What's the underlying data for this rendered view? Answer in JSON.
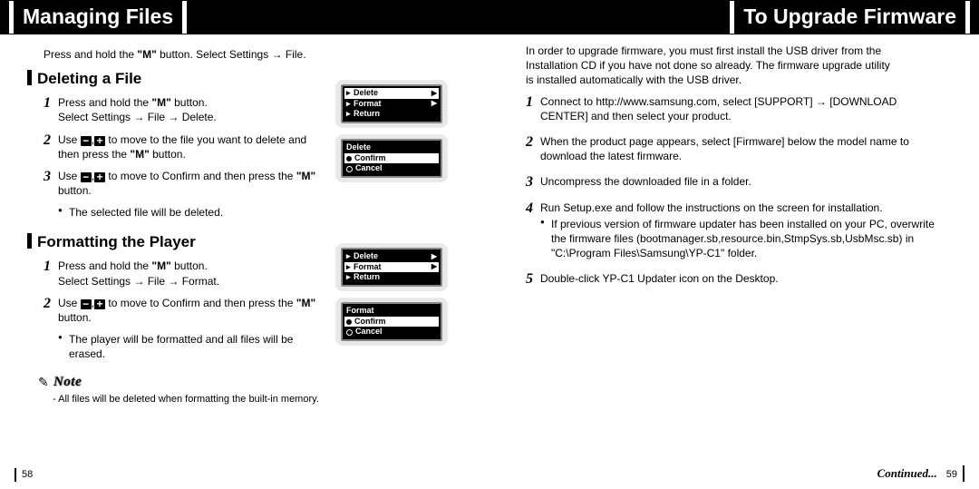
{
  "header": {
    "left_title": "Managing Files",
    "right_title": "To Upgrade Firmware"
  },
  "left": {
    "intro_pre": "Press and hold the ",
    "intro_m": "\"M\"",
    "intro_post": " button. Select Settings → File.",
    "del_head": "Deleting a File",
    "del_s1a": "Press and hold the ",
    "del_s1b": "\"M\"",
    "del_s1c": " button.",
    "del_s1d": "Select Settings → File → Delete.",
    "del_s2a": "Use ",
    "del_s2b": " to move to the file you want to delete and then press the ",
    "del_s2c": "\"M\"",
    "del_s2d": " button.",
    "del_s3a": "Use ",
    "del_s3b": " to move to Confirm and then press the ",
    "del_s3c": "\"M\"",
    "del_s3d": " button.",
    "del_b1": "The selected file will be deleted.",
    "fmt_head": "Formatting the Player",
    "fmt_s1a": "Press and hold the ",
    "fmt_s1b": "\"M\"",
    "fmt_s1c": " button.",
    "fmt_s1d": "Select Settings → File → Format.",
    "fmt_s2a": "Use ",
    "fmt_s2b": " to move to Confirm and then press the ",
    "fmt_s2c": "\"M\"",
    "fmt_s2d": " button.",
    "fmt_b1": "The player will be formatted and all files will be erased.",
    "note_label": "Note",
    "note_body": "- All files will be deleted when formatting the built-in memory.",
    "page": "58"
  },
  "right": {
    "intro1": "In order to upgrade firmware, you must first install the USB driver from the",
    "intro2": "Installation CD if you have not done so already. The firmware upgrade utility",
    "intro3": "is installed automatically with the USB driver.",
    "s1": "Connect to http://www.samsung.com, select [SUPPORT] → [DOWNLOAD CENTER] and then select your product.",
    "s2": "When the product page appears, select [Firmware] below the model name to download the latest firmware.",
    "s3": "Uncompress the downloaded file in a folder.",
    "s4": "Run Setup.exe and follow the instructions on the screen for installation.",
    "s4b1": "If previous version of firmware updater has been installed on your PC, overwrite the firmware files (bootmanager.sb,resource.bin,StmpSys.sb,UsbMsc.sb) in \"C:\\Program Files\\Samsung\\YP-C1\" folder.",
    "s5": "Double-click YP-C1 Updater icon on the Desktop.",
    "continued": "Continued...",
    "page": "59"
  },
  "screens": {
    "a": {
      "i1": "Delete",
      "i2": "Format",
      "i3": "Return"
    },
    "b": {
      "i1": "Delete",
      "i2": "Confirm",
      "i3": "Cancel"
    },
    "c": {
      "i1": "Delete",
      "i2": "Format",
      "i3": "Return"
    },
    "d": {
      "i1": "Format",
      "i2": "Confirm",
      "i3": "Cancel"
    }
  },
  "icons": {
    "minus": "−",
    "plus": "+",
    "sep": ",",
    "pencil": "✎"
  }
}
